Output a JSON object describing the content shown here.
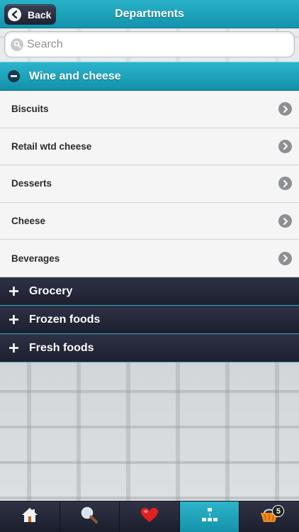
{
  "header": {
    "title": "Departments",
    "back_label": "Back"
  },
  "search": {
    "placeholder": "Search",
    "value": ""
  },
  "departments": {
    "open": {
      "label": "Wine and cheese",
      "items": [
        "Biscuits",
        "Retail wtd cheese",
        "Desserts",
        "Cheese",
        "Beverages"
      ]
    },
    "closed": [
      "Grocery",
      "Frozen foods",
      "Fresh foods"
    ]
  },
  "tabbar": {
    "tabs": [
      {
        "icon": "home-icon"
      },
      {
        "icon": "search-icon"
      },
      {
        "icon": "heart-icon"
      },
      {
        "icon": "departments-icon",
        "active": true
      },
      {
        "icon": "basket-icon",
        "badge": "5"
      }
    ]
  },
  "colors": {
    "accent": "#1ea3bc",
    "dark": "#1f2233",
    "heart": "#e0201f",
    "basket": "#f08a1c"
  }
}
